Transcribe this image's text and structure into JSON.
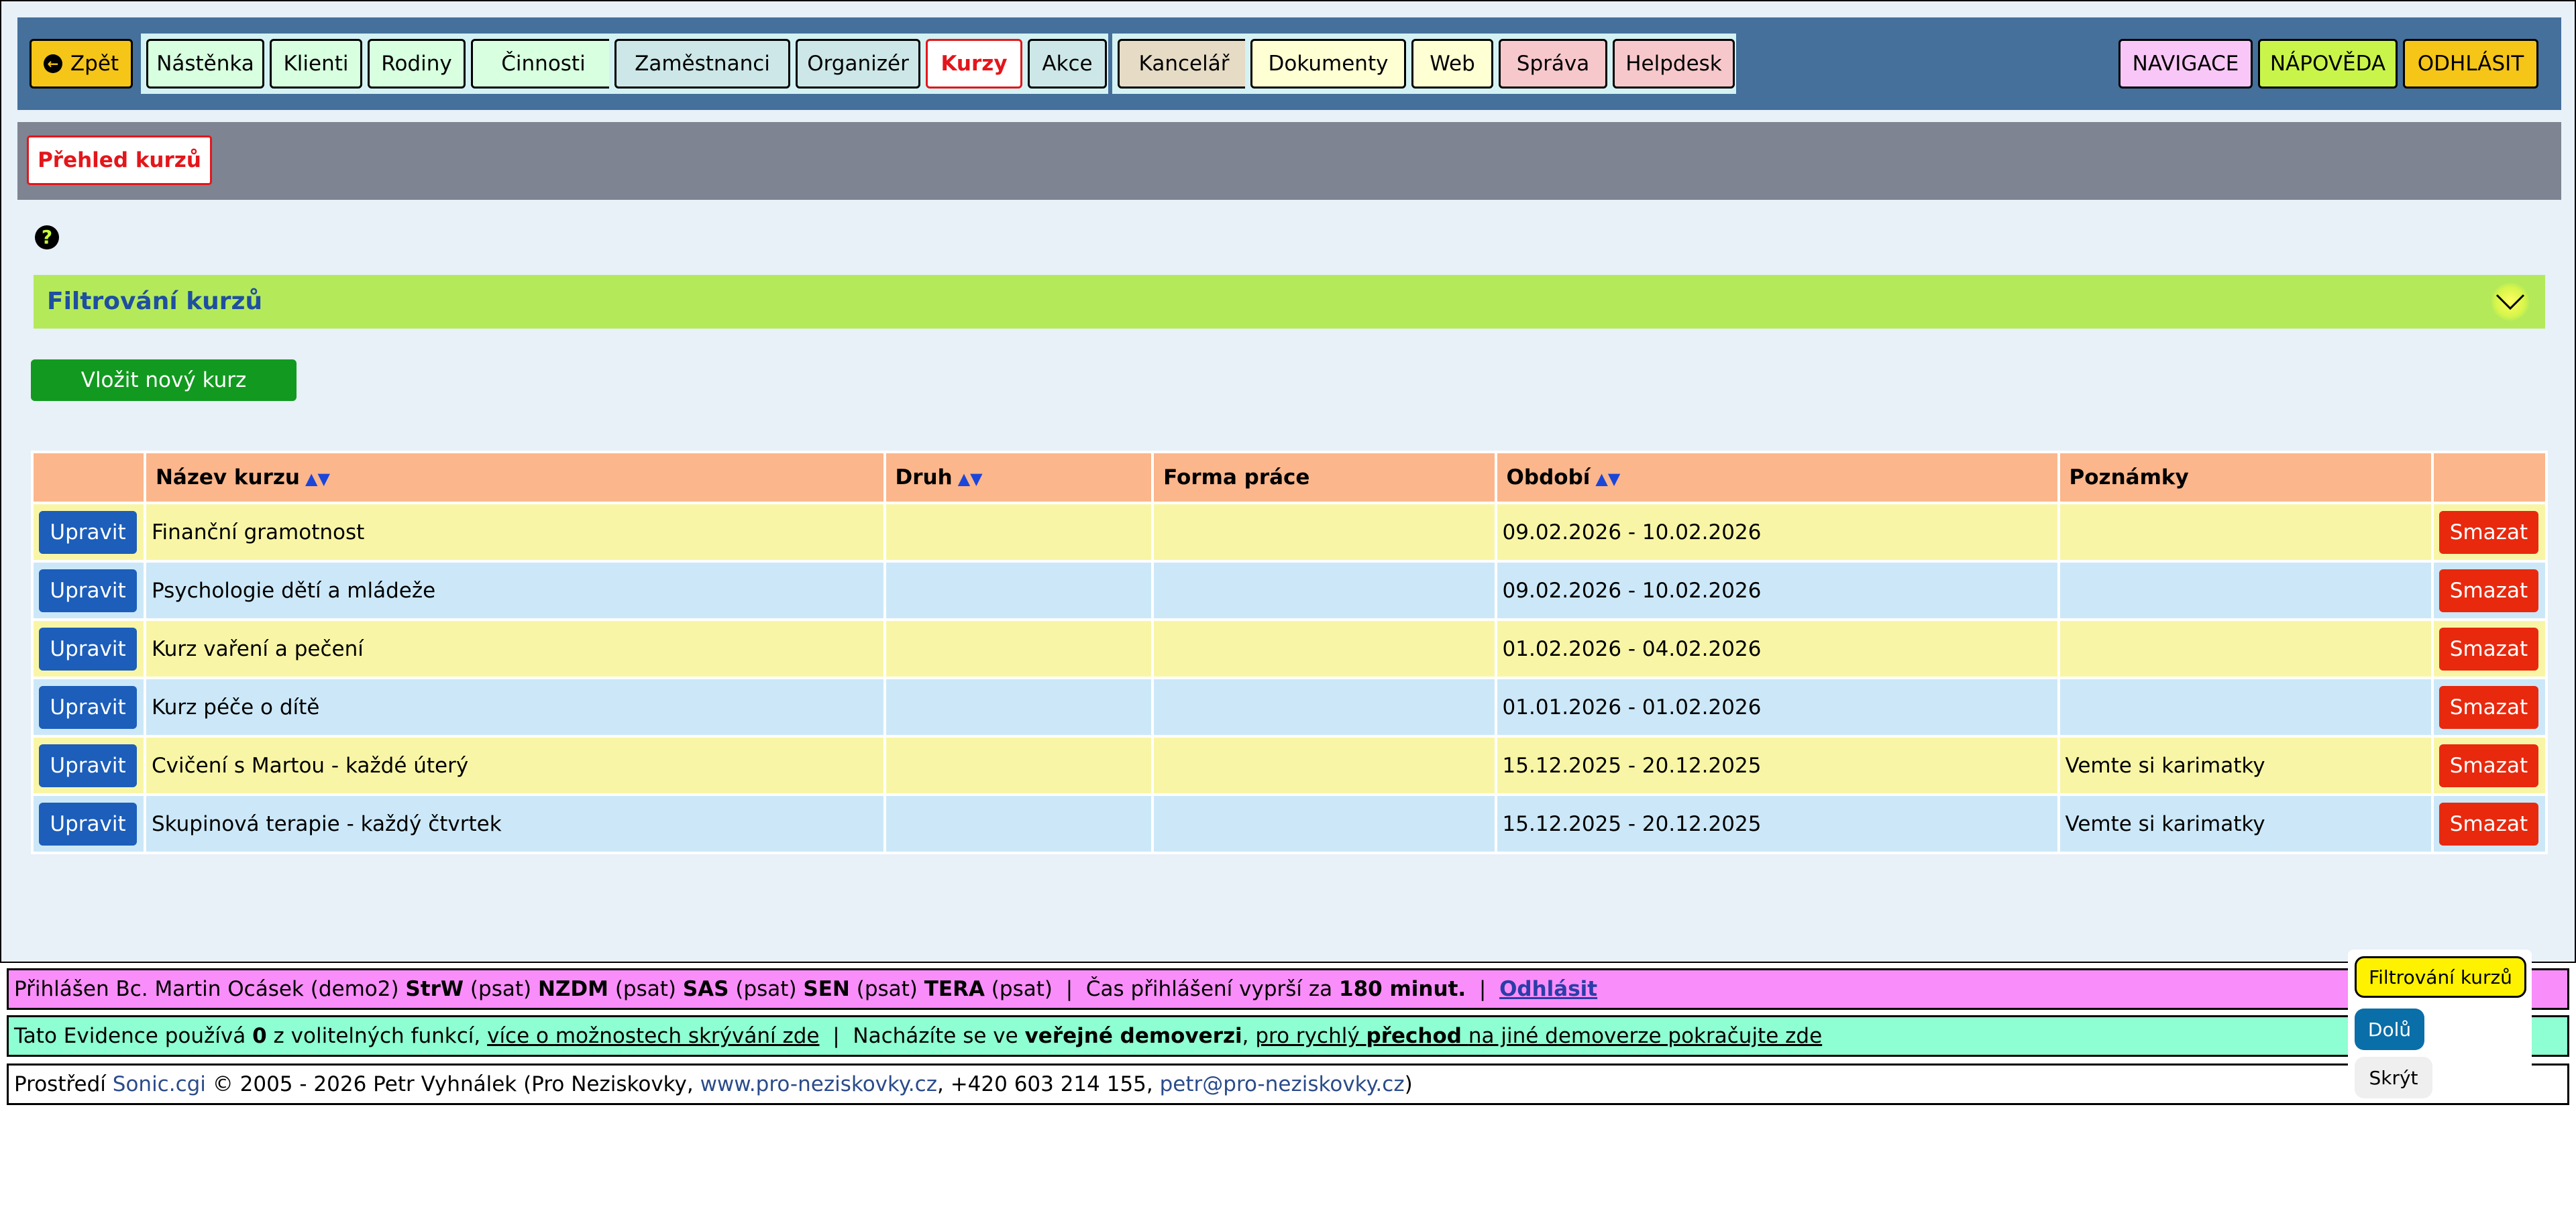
{
  "topnav": {
    "back_label": "Zpět",
    "group1": [
      "Nástěnka",
      "Klienti",
      "Rodiny",
      "Činnosti"
    ],
    "group2": [
      "Zaměstnanci",
      "Organizér",
      "Kurzy",
      "Akce"
    ],
    "group3": [
      "Kancelář"
    ],
    "group4": [
      "Dokumenty",
      "Web"
    ],
    "group5": [
      "Správa",
      "Helpdesk"
    ],
    "right": [
      "NAVIGACE",
      "NÁPOVĚDA",
      "ODHLÁSIT"
    ],
    "active": "Kurzy",
    "colors": {
      "nav_bg": "#44709b",
      "active_text": "#e3161b"
    }
  },
  "subheader": {
    "tab_label": "Přehled kurzů"
  },
  "filter": {
    "title": "Filtrování kurzů"
  },
  "add_button_label": "Vložit nový kurz",
  "table": {
    "headers": [
      "",
      "Název kurzu",
      "Druh",
      "Forma práce",
      "Období",
      "Poznámky",
      ""
    ],
    "sort_arrows": "▲▼",
    "edit_label": "Upravit",
    "delete_label": "Smazat",
    "rows": [
      {
        "name": "Finanční gramotnost",
        "druh": "",
        "forma": "",
        "obdobi": "09.02.2026 - 10.02.2026",
        "note": ""
      },
      {
        "name": "Psychologie dětí a mládeže",
        "druh": "",
        "forma": "",
        "obdobi": "09.02.2026 - 10.02.2026",
        "note": ""
      },
      {
        "name": "Kurz vaření a pečení",
        "druh": "",
        "forma": "",
        "obdobi": "01.02.2026 - 04.02.2026",
        "note": ""
      },
      {
        "name": "Kurz péče o dítě",
        "druh": "",
        "forma": "",
        "obdobi": "01.01.2026 - 01.02.2026",
        "note": ""
      },
      {
        "name": "Cvičení s Martou - každé úterý",
        "druh": "",
        "forma": "",
        "obdobi": "15.12.2025 - 20.12.2025",
        "note": "Vemte si karimatky"
      },
      {
        "name": "Skupinová terapie - každý čtvrtek",
        "druh": "",
        "forma": "",
        "obdobi": "15.12.2025 - 20.12.2025",
        "note": "Vemte si karimatky"
      }
    ]
  },
  "footer": {
    "login": {
      "prefix": "Přihlášen Bc. Martin Ocásek (demo2)",
      "roles": [
        {
          "code": "StrW",
          "perm": "(psat)"
        },
        {
          "code": "NZDM",
          "perm": "(psat)"
        },
        {
          "code": "SAS",
          "perm": "(psat)"
        },
        {
          "code": "SEN",
          "perm": "(psat)"
        },
        {
          "code": "TERA",
          "perm": "(psat)"
        }
      ],
      "separator": "|",
      "expire_text": "Čas přihlášení vyprší za",
      "expire_value": "180 minut.",
      "logout_link": "Odhlásit"
    },
    "features": {
      "part1": "Tato Evidence používá",
      "count": "0",
      "part2": "z volitelných funkcí,",
      "link1": "více o možnostech skrývání zde",
      "separator": "|",
      "part3": "Nacházíte se ve",
      "bold1": "veřejné demoverzi",
      "comma": ",",
      "link2a": "pro rychlý",
      "link2b": "přechod",
      "link2c": "na jiné demoverze pokračujte zde"
    },
    "copyright": {
      "part1": "Prostředí",
      "sonic": "Sonic.cgi",
      "part2": "© 2005 - 2026 Petr Vyhnálek (Pro Neziskovky,",
      "web": "www.pro-neziskovky.cz",
      "part3": ", +420 603 214 155,",
      "email": "petr@pro-neziskovky.cz",
      "part4": ")"
    }
  },
  "float_panel": {
    "filter_label": "Filtrování kurzů",
    "down_label": "Dolů",
    "hide_label": "Skrýt"
  }
}
